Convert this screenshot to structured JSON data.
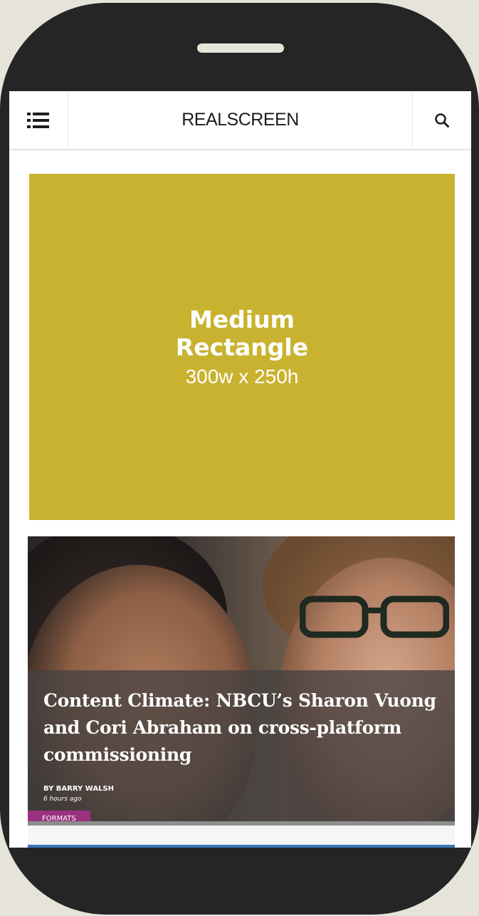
{
  "header": {
    "logo_text": "REALSCREEN",
    "menu_icon": "menu-list-icon",
    "search_icon": "search-icon"
  },
  "ad": {
    "title_line1": "Medium",
    "title_line2": "Rectangle",
    "size": "300w x 250h",
    "background": "#c9b22f"
  },
  "article": {
    "headline": "Content Climate: NBCU’s Sharon Vuong and Cori Abraham on cross-platform commissioning",
    "byline": "BY BARRY WALSH",
    "time": "6 hours ago",
    "tag": "FORMATS",
    "tag_color": "#9b3281"
  }
}
